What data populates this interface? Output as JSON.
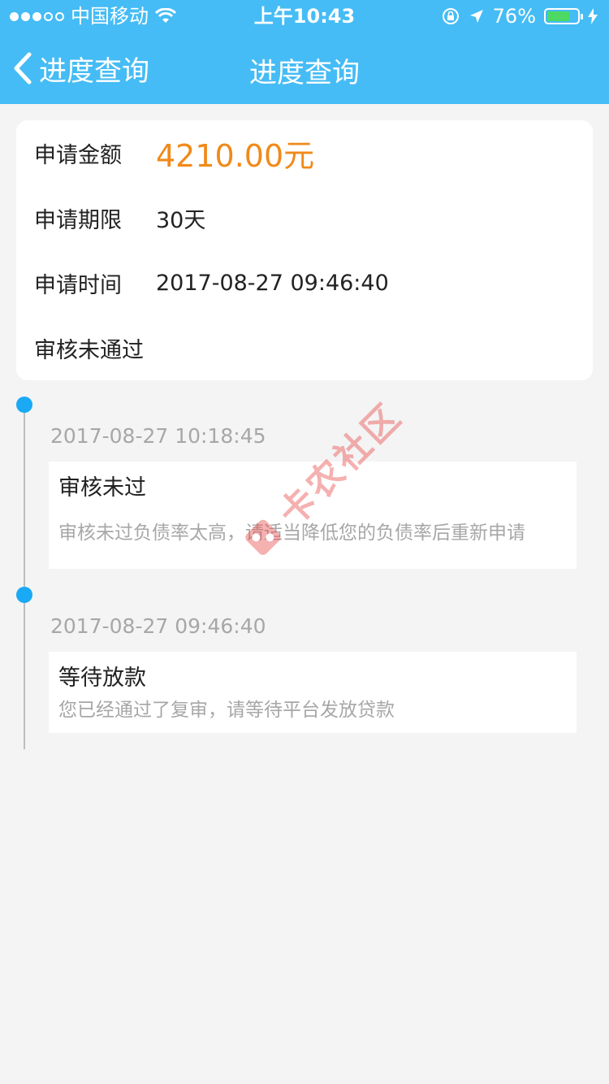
{
  "status_bar": {
    "carrier": "中国移动",
    "time": "上午10:43",
    "battery_pct": "76%",
    "battery_level": 0.76
  },
  "nav": {
    "back_label": "进度查询",
    "title": "进度查询"
  },
  "summary": {
    "amount_label": "申请金额",
    "amount_value": "4210.00元",
    "term_label": "申请期限",
    "term_value": "30天",
    "time_label": "申请时间",
    "time_value": "2017-08-27 09:46:40",
    "status_text": "审核未通过"
  },
  "timeline": [
    {
      "time": "2017-08-27 10:18:45",
      "title": "审核未过",
      "desc": "审核未过负债率太高，请适当降低您的负债率后重新申请"
    },
    {
      "time": "2017-08-27 09:46:40",
      "title": "等待放款",
      "desc": "您已经通过了复审，请等待平台发放贷款"
    }
  ],
  "watermark_text": "卡农社区",
  "colors": {
    "header": "#45bcf5",
    "accent_amount": "#f08a1a",
    "timeline_dot": "#1aa9f5"
  }
}
